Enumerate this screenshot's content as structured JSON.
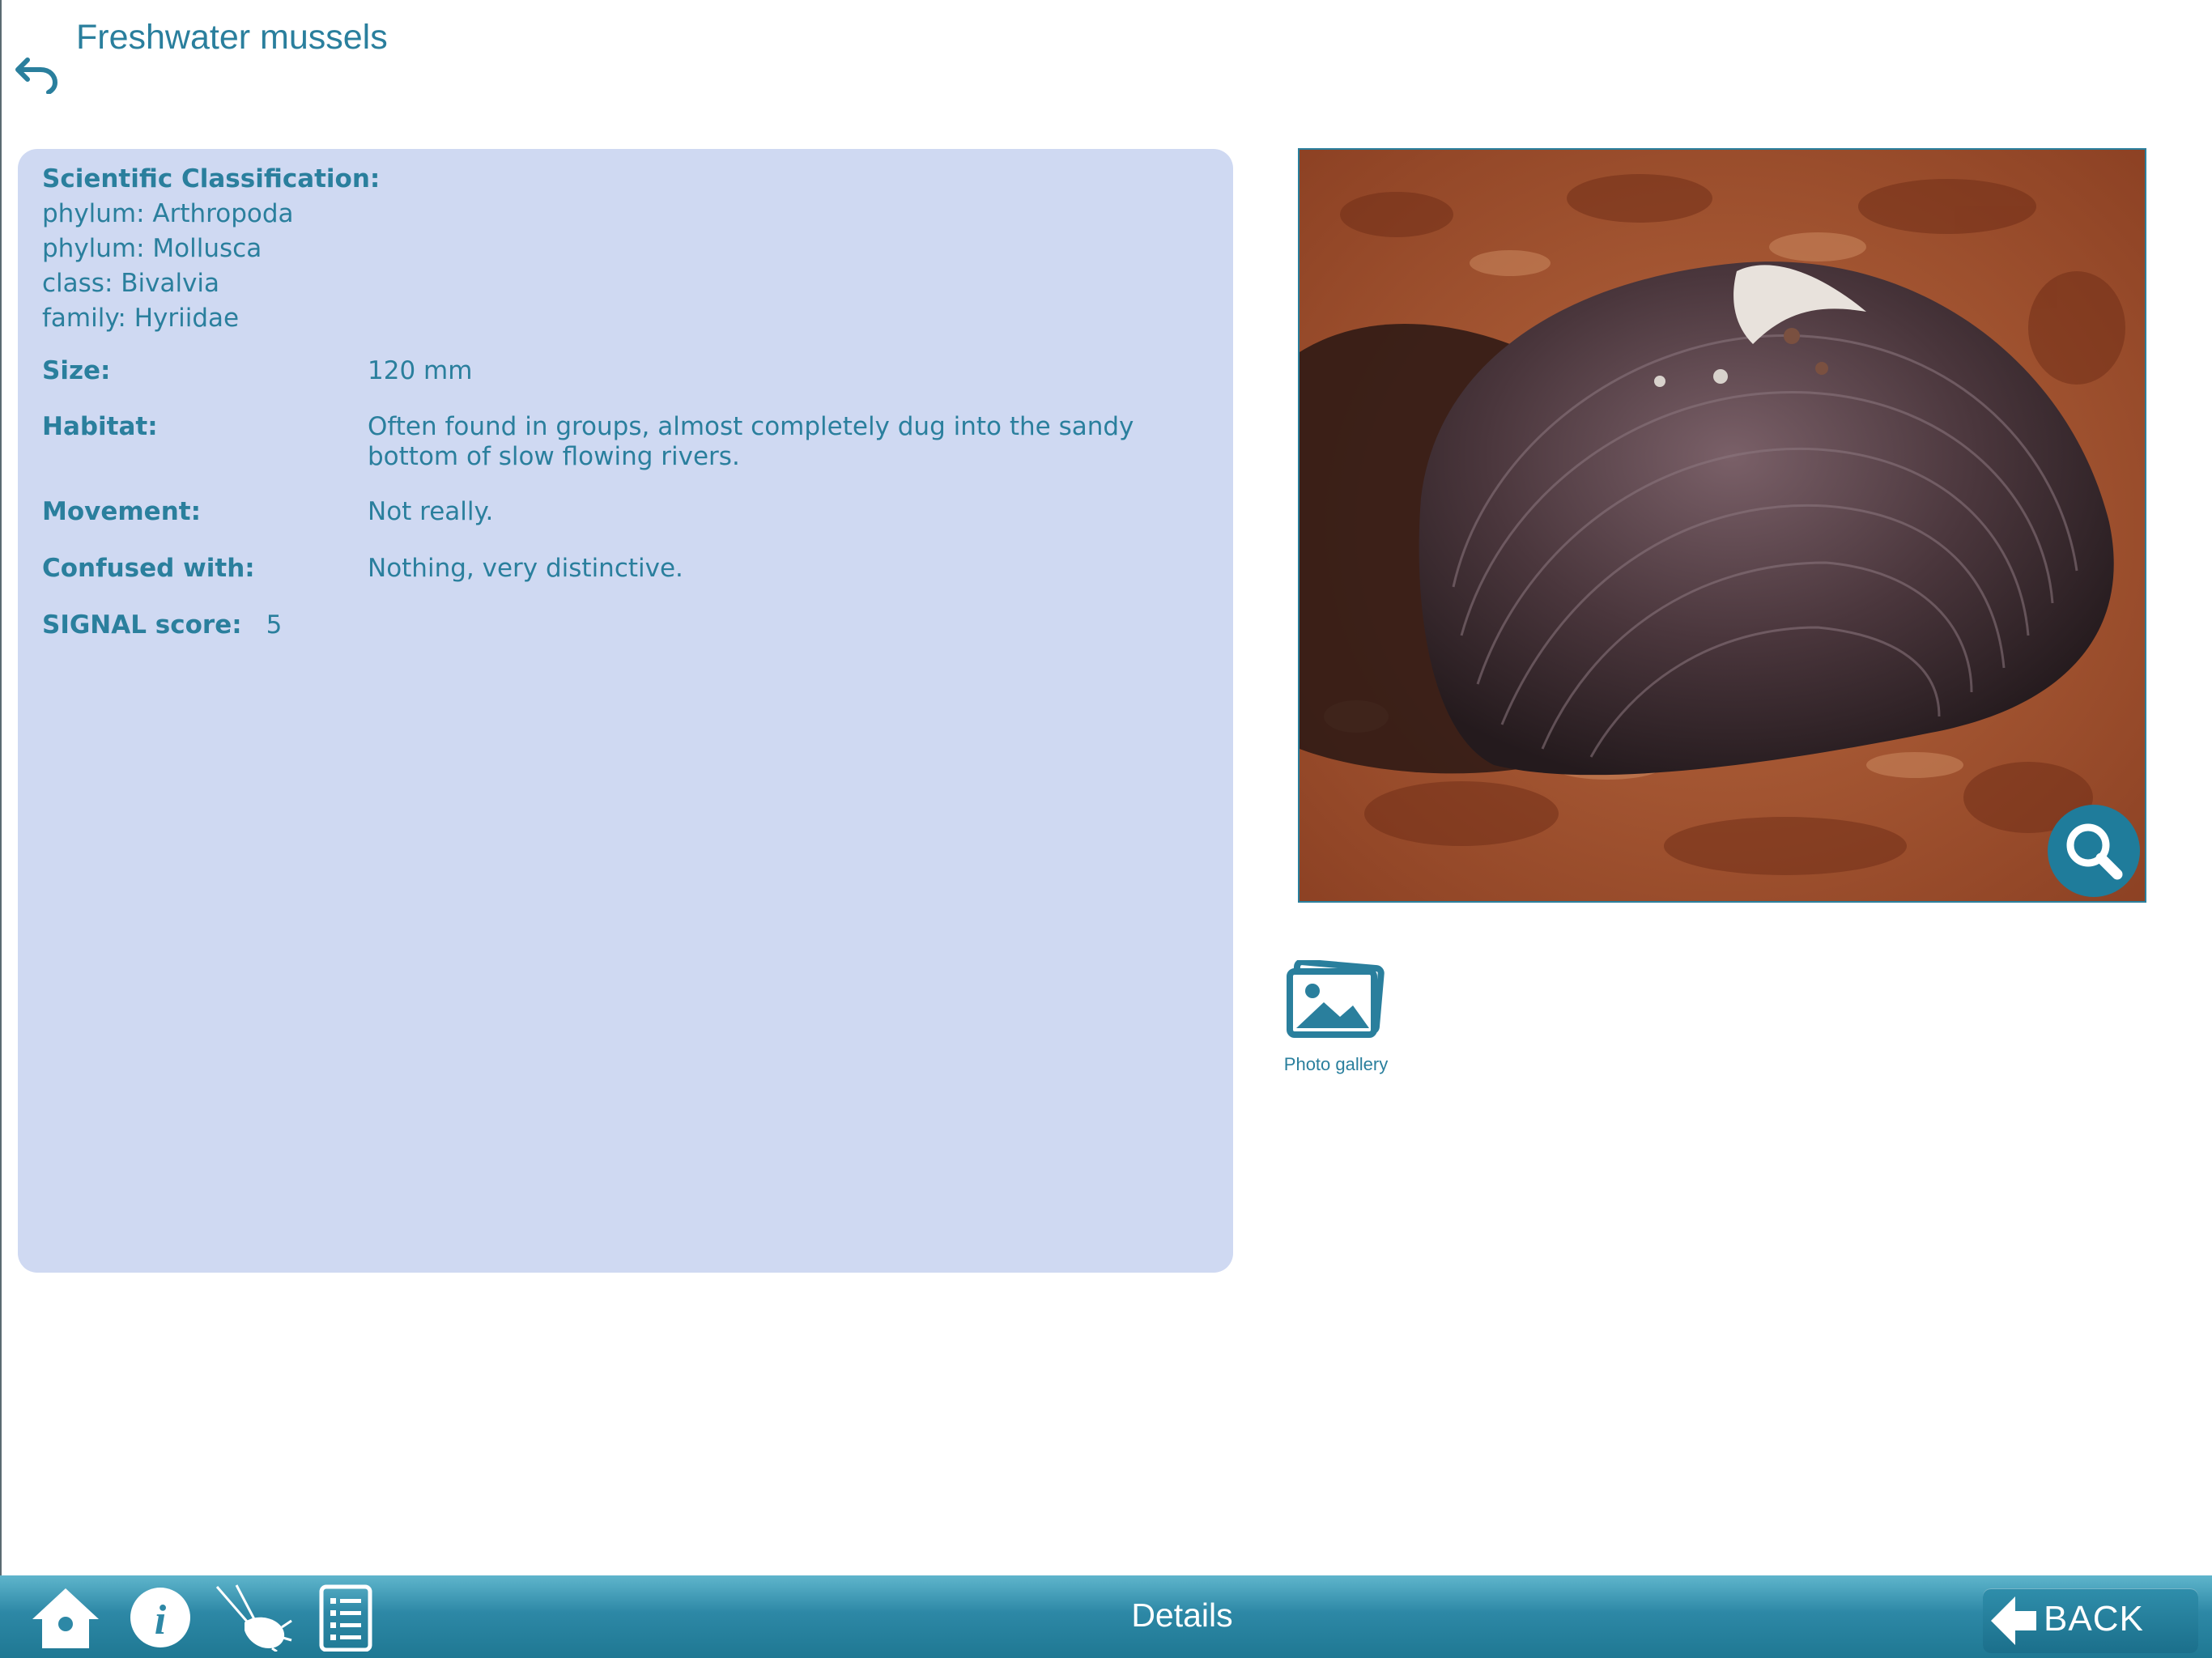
{
  "header": {
    "title": "Freshwater mussels"
  },
  "classification": {
    "heading": "Scientific Classification:",
    "lines": [
      "phylum: Arthropoda",
      "phylum: Mollusca",
      "class: Bivalvia",
      "family: Hyriidae"
    ]
  },
  "details": {
    "size": {
      "label": "Size:",
      "value": "120 mm"
    },
    "habitat": {
      "label": "Habitat:",
      "value": "Often found in groups, almost completely dug into the sandy bottom of slow flowing rivers."
    },
    "movement": {
      "label": "Movement:",
      "value": "Not really."
    },
    "confused": {
      "label": "Confused with:",
      "value": "Nothing, very distinctive."
    },
    "signal": {
      "label": "SIGNAL score:",
      "value": "5"
    }
  },
  "gallery": {
    "label": "Photo gallery"
  },
  "toolbar": {
    "title": "Details",
    "back_label": "BACK"
  },
  "colors": {
    "accent": "#2a7f9d",
    "panel": "#cfd9f2",
    "toolbar": "#2d88a6"
  }
}
